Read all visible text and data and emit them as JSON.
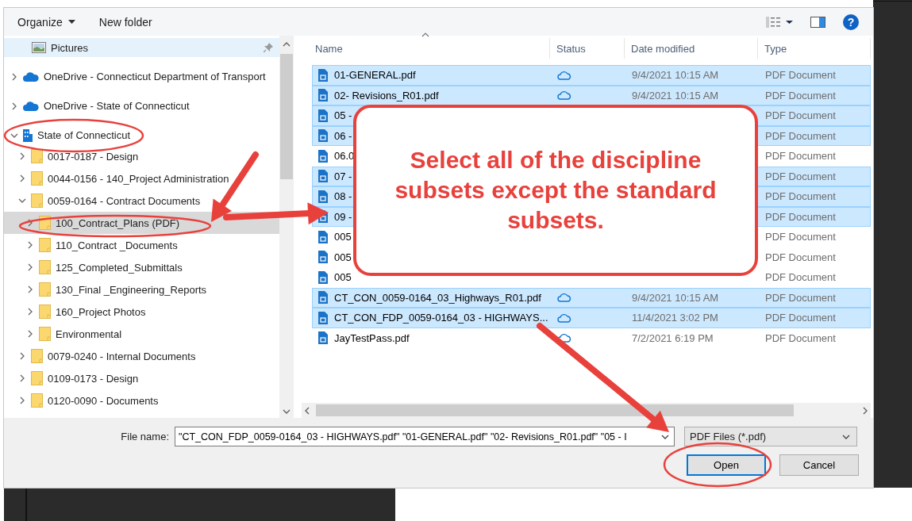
{
  "toolbar": {
    "organize": "Organize",
    "new_folder": "New folder",
    "help": "?"
  },
  "navigation": {
    "items": [
      {
        "label": "Pictures",
        "kind": "picture",
        "pinned": true,
        "selected": false
      },
      {
        "label": "OneDrive - Connecticut Department of Transport",
        "kind": "cloud",
        "expanded": false,
        "selected": false
      },
      {
        "label": "OneDrive - State of Connecticut",
        "kind": "cloud",
        "expanded": false,
        "selected": false
      },
      {
        "label": "State of Connecticut",
        "kind": "building",
        "expanded": true,
        "selected": false,
        "children": [
          {
            "label": "0017-0187 - Design",
            "kind": "folder",
            "expanded": false,
            "selected": false
          },
          {
            "label": "0044-0156 - 140_Project Administration",
            "kind": "folder",
            "expanded": false,
            "selected": false
          },
          {
            "label": "0059-0164 - Contract Documents",
            "kind": "folder",
            "expanded": true,
            "selected": false,
            "children": [
              {
                "label": "100_Contract_Plans (PDF)",
                "kind": "folder",
                "expanded": false,
                "selected": true
              },
              {
                "label": "110_Contract _Documents",
                "kind": "folder",
                "expanded": false,
                "selected": false
              },
              {
                "label": "125_Completed_Submittals",
                "kind": "folder",
                "expanded": false,
                "selected": false
              },
              {
                "label": "130_Final _Engineering_Reports",
                "kind": "folder",
                "expanded": false,
                "selected": false
              },
              {
                "label": "160_Project Photos",
                "kind": "folder",
                "expanded": false,
                "selected": false
              },
              {
                "label": "Environmental",
                "kind": "folder",
                "expanded": false,
                "selected": false
              }
            ]
          },
          {
            "label": "0079-0240 - Internal Documents",
            "kind": "folder",
            "expanded": false,
            "selected": false
          },
          {
            "label": "0109-0173 - Design",
            "kind": "folder",
            "expanded": false,
            "selected": false
          },
          {
            "label": "0120-0090 - Documents",
            "kind": "folder",
            "expanded": false,
            "selected": false
          }
        ]
      }
    ]
  },
  "file_list": {
    "columns": [
      {
        "label": "Name",
        "sorted": true
      },
      {
        "label": "Status",
        "sorted": false
      },
      {
        "label": "Date modified",
        "sorted": false
      },
      {
        "label": "Type",
        "sorted": false
      }
    ],
    "rows": [
      {
        "name": "01-GENERAL.pdf",
        "synced": true,
        "date": "9/4/2021 10:15 AM",
        "type": "PDF Document",
        "selected": true
      },
      {
        "name": "02- Revisions_R01.pdf",
        "synced": true,
        "date": "9/4/2021 10:15 AM",
        "type": "PDF Document",
        "selected": true
      },
      {
        "name": "05 -",
        "type": "PDF Document",
        "selected": true
      },
      {
        "name": "06 -",
        "type": "PDF Document",
        "selected": true
      },
      {
        "name": "06.0",
        "type": "PDF Document",
        "selected": false
      },
      {
        "name": "07 -",
        "type": "PDF Document",
        "selected": true
      },
      {
        "name": "08 -",
        "type": "PDF Document",
        "selected": true
      },
      {
        "name": "09 -",
        "type": "PDF Document",
        "selected": true
      },
      {
        "name": "005",
        "type": "PDF Document",
        "selected": false
      },
      {
        "name": "005",
        "type": "PDF Document",
        "selected": false
      },
      {
        "name": "005",
        "type": "PDF Document",
        "selected": false
      },
      {
        "name": "CT_CON_0059-0164_03_Highways_R01.pdf",
        "synced": true,
        "date": "9/4/2021 10:15 AM",
        "type": "PDF Document",
        "selected": true
      },
      {
        "name": "CT_CON_FDP_0059-0164_03 - HIGHWAYS...",
        "synced": true,
        "date": "11/4/2021 3:02 PM",
        "type": "PDF Document",
        "selected": true
      },
      {
        "name": "JayTestPass.pdf",
        "synced": true,
        "date": "7/2/2021 6:19 PM",
        "type": "PDF Document",
        "selected": false
      }
    ]
  },
  "file_name": {
    "label": "File name:",
    "value": "\"CT_CON_FDP_0059-0164_03 - HIGHWAYS.pdf\" \"01-GENERAL.pdf\" \"02- Revisions_R01.pdf\" \"05 - I"
  },
  "file_type": {
    "value": "PDF Files (*.pdf)"
  },
  "buttons": [
    {
      "label": "Open",
      "default": true
    },
    {
      "label": "Cancel",
      "default": false
    }
  ],
  "callout": {
    "text": "Select all of the discipline subsets except the standard subsets."
  }
}
